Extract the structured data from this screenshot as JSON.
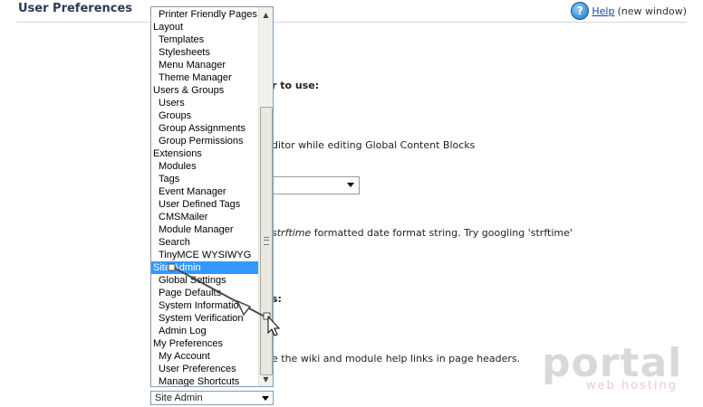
{
  "header": {
    "title": "User Preferences",
    "help_icon": "help-icon",
    "help_label": "Help",
    "help_suffix": "(new window)"
  },
  "background_text": {
    "editor_heading": "r to use:",
    "gcb_text": "ditor while editing Global Content Blocks",
    "date_prefix": "strftime",
    "date_suffix": " formatted date format string. Try googling 'strftime'",
    "colon": "s:",
    "wiki_text": "e the wiki and module help links in page headers."
  },
  "dropdown": {
    "items": [
      {
        "label": "Printer Friendly Pages",
        "child": true
      },
      {
        "label": "Layout",
        "child": false
      },
      {
        "label": "Templates",
        "child": true
      },
      {
        "label": "Stylesheets",
        "child": true
      },
      {
        "label": "Menu Manager",
        "child": true
      },
      {
        "label": "Theme Manager",
        "child": true
      },
      {
        "label": "Users & Groups",
        "child": false
      },
      {
        "label": "Users",
        "child": true
      },
      {
        "label": "Groups",
        "child": true
      },
      {
        "label": "Group Assignments",
        "child": true
      },
      {
        "label": "Group Permissions",
        "child": true
      },
      {
        "label": "Extensions",
        "child": false
      },
      {
        "label": "Modules",
        "child": true
      },
      {
        "label": "Tags",
        "child": true
      },
      {
        "label": "Event Manager",
        "child": true
      },
      {
        "label": "User Defined Tags",
        "child": true
      },
      {
        "label": "CMSMailer",
        "child": true
      },
      {
        "label": "Module Manager",
        "child": true
      },
      {
        "label": "Search",
        "child": true
      },
      {
        "label": "TinyMCE WYSIWYG",
        "child": true
      },
      {
        "label": "Site Admin",
        "child": false,
        "selected": true
      },
      {
        "label": "Global Settings",
        "child": true
      },
      {
        "label": "Page Defaults",
        "child": true
      },
      {
        "label": "System Information",
        "child": true
      },
      {
        "label": "System Verification",
        "child": true
      },
      {
        "label": "Admin Log",
        "child": true
      },
      {
        "label": "My Preferences",
        "child": false
      },
      {
        "label": "My Account",
        "child": true
      },
      {
        "label": "User Preferences",
        "child": true
      },
      {
        "label": "Manage Shortcuts",
        "child": true
      }
    ],
    "selected_value": "Site Admin"
  },
  "watermark": {
    "brand": "portal",
    "sub": "web hosting"
  },
  "colors": {
    "selection": "#3399ff",
    "title": "#2b3a55",
    "link": "#1a3e9e"
  }
}
